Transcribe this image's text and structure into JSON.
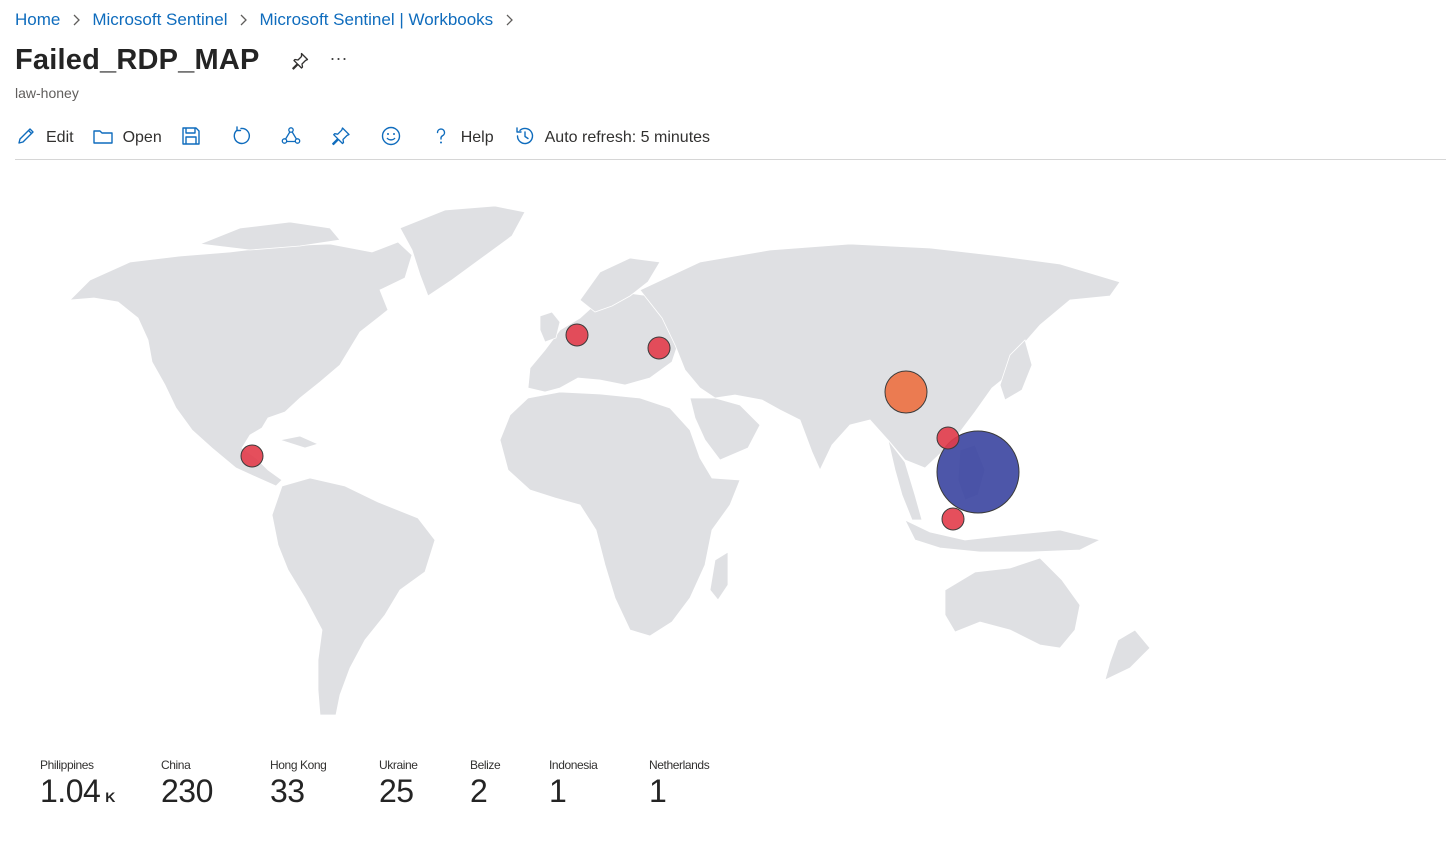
{
  "breadcrumb": [
    "Home",
    "Microsoft Sentinel",
    "Microsoft Sentinel | Workbooks"
  ],
  "title": "Failed_RDP_MAP",
  "more_label": "···",
  "subtitle": "law-honey",
  "toolbar": {
    "edit": "Edit",
    "open": "Open",
    "help": "Help",
    "auto_refresh": "Auto refresh: 5 minutes"
  },
  "icons": [
    "chevron-right-icon",
    "pin-icon",
    "edit-icon",
    "folder-icon",
    "save-icon",
    "refresh-icon",
    "share-icon",
    "smiley-icon",
    "question-icon",
    "history-icon"
  ],
  "colors": {
    "link": "#0f6cbd",
    "land": "#dfe0e3",
    "high": "#3a44a0",
    "mid": "#ec7040",
    "low": "#e23c4a"
  },
  "tiles": [
    {
      "label": "Philippines",
      "value": "1.04",
      "unit": "K"
    },
    {
      "label": "China",
      "value": "230"
    },
    {
      "label": "Hong Kong",
      "value": "33"
    },
    {
      "label": "Ukraine",
      "value": "25"
    },
    {
      "label": "Belize",
      "value": "2"
    },
    {
      "label": "Indonesia",
      "value": "1"
    },
    {
      "label": "Netherlands",
      "value": "1"
    }
  ],
  "map_points": [
    {
      "country": "Philippines",
      "count": 1040
    },
    {
      "country": "China",
      "count": 230
    },
    {
      "country": "Hong Kong",
      "count": 33
    },
    {
      "country": "Ukraine",
      "count": 25
    },
    {
      "country": "Belize",
      "count": 2
    },
    {
      "country": "Indonesia",
      "count": 1
    },
    {
      "country": "Netherlands",
      "count": 1
    }
  ]
}
